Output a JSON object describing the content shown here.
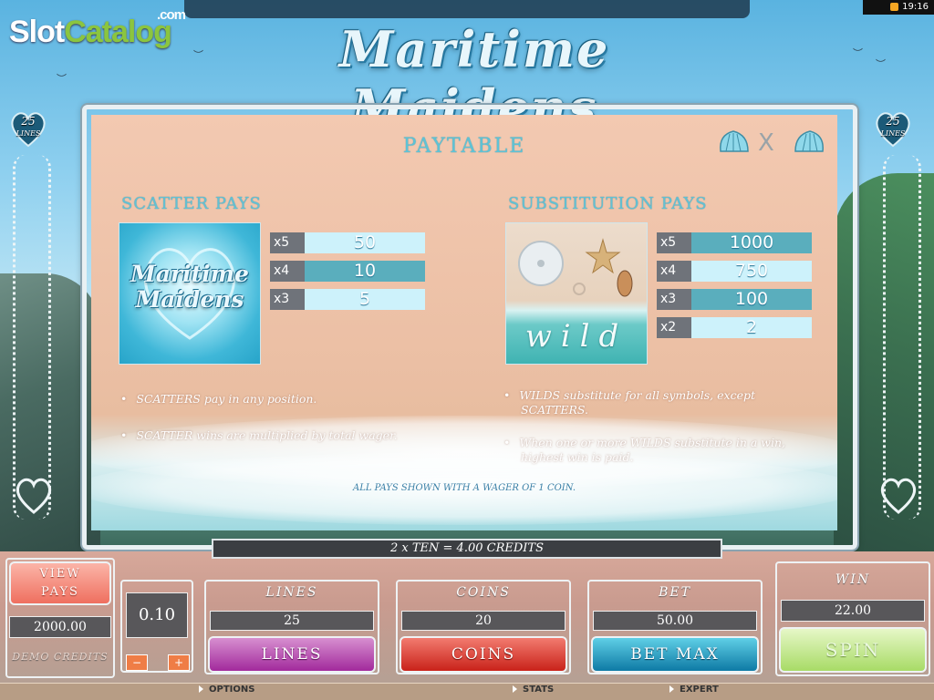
{
  "watermark": {
    "part1": "Slot",
    "part2": "Catalog",
    "suffix": ".com"
  },
  "system": {
    "time": "19:16",
    "icon": "wallet-icon"
  },
  "game": {
    "title": "Maritime Maidens",
    "lines_badge": {
      "count": "25",
      "label": "LINES"
    }
  },
  "paytable": {
    "title": "PAYTABLE",
    "nav": {
      "prev_icon": "shell-left-icon",
      "close_label": "X",
      "next_icon": "shell-right-icon"
    },
    "scatter": {
      "title": "SCATTER PAYS",
      "symbol_text_line1": "Maritime",
      "symbol_text_line2": "Maidens",
      "pays": [
        {
          "mult": "x5",
          "value": "50"
        },
        {
          "mult": "x4",
          "value": "10"
        },
        {
          "mult": "x3",
          "value": "5"
        }
      ],
      "notes": [
        "SCATTERS pay in any position.",
        "SCATTER wins are multiplied by total wager."
      ]
    },
    "substitution": {
      "title": "SUBSTITUTION PAYS",
      "symbol_text": "wild",
      "pays": [
        {
          "mult": "x5",
          "value": "1000"
        },
        {
          "mult": "x4",
          "value": "750"
        },
        {
          "mult": "x3",
          "value": "100"
        },
        {
          "mult": "x2",
          "value": "2"
        }
      ],
      "notes": [
        "WILDS substitute for all symbols, except",
        "SCATTERS.",
        "When one or more WILDS substitute in a win,",
        "highest win is paid."
      ]
    },
    "footnote": "ALL PAYS SHOWN WITH A WAGER OF 1 COIN."
  },
  "message": "2 x TEN  =  4.00 CREDITS",
  "controls": {
    "view_pays": {
      "line1": "VIEW",
      "line2": "PAYS"
    },
    "credits": {
      "value": "2000.00",
      "label": "DEMO CREDITS"
    },
    "coin_size": {
      "value": "0.10",
      "minus": "−",
      "plus": "+"
    },
    "lines": {
      "label": "LINES",
      "value": "25",
      "button": "LINES"
    },
    "coins": {
      "label": "COINS",
      "value": "20",
      "button": "COINS"
    },
    "bet": {
      "label": "BET",
      "value": "50.00",
      "button": "BET MAX"
    },
    "win": {
      "label": "WIN",
      "value": "22.00",
      "button": "SPIN"
    }
  },
  "statusbar": {
    "options": "OPTIONS",
    "stats": "STATS",
    "expert": "EXPERT"
  },
  "colors": {
    "accent": "#5ec3d6",
    "pay_dark": "#5aaebd",
    "pay_light": "#cdf2fb",
    "sand": "#f3c9b1"
  }
}
